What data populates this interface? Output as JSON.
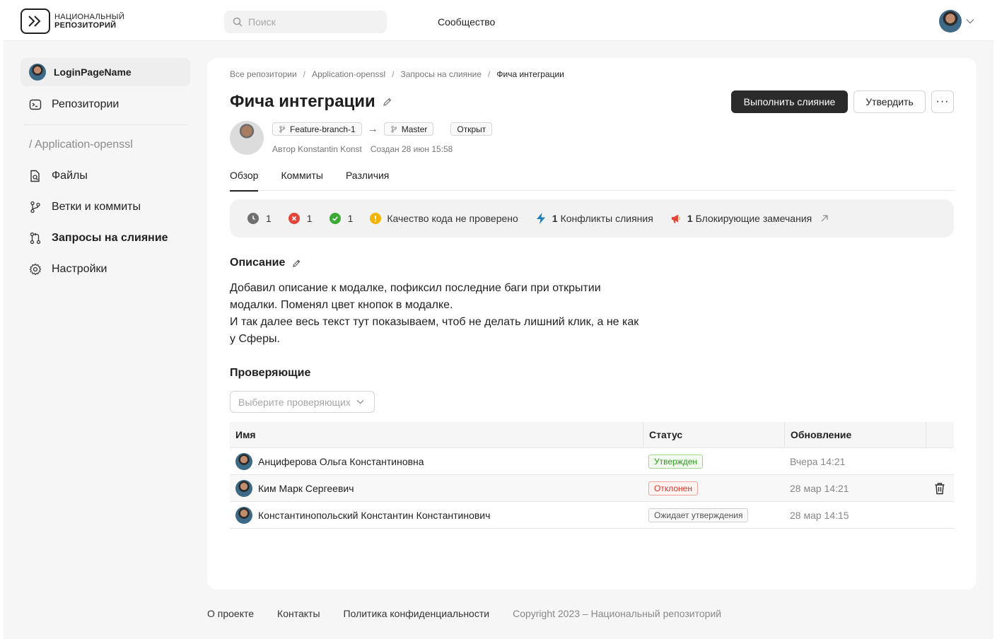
{
  "header": {
    "logo_line1": "НАЦИОНАЛЬНЫЙ",
    "logo_line2": "РЕПОЗИТОРИЙ",
    "search_placeholder": "Поиск",
    "community": "Сообщество"
  },
  "sidebar": {
    "user": "LoginPageName",
    "repos": "Репозитории",
    "repo_path": "/  Application-openssl",
    "items": [
      {
        "label": "Файлы",
        "icon": "file-search-icon"
      },
      {
        "label": "Ветки и коммиты",
        "icon": "branch-icon"
      },
      {
        "label": "Запросы на слияние",
        "icon": "pull-request-icon",
        "active": true
      },
      {
        "label": "Настройки",
        "icon": "gear-icon"
      }
    ]
  },
  "breadcrumb": [
    "Все репозитории",
    "Application-openssl",
    "Запросы на слияние",
    "Фича интеграции"
  ],
  "page": {
    "title": "Фича интеграции",
    "merge_button": "Выполнить слияние",
    "approve_button": "Утвердить",
    "more_button": "···",
    "source_branch": "Feature-branch-1",
    "target_branch": "Master",
    "status": "Открыт",
    "author": "Автор Konstantin Konst",
    "created": "Создан 28 июн 15:58"
  },
  "tabs": [
    "Обзор",
    "Коммиты",
    "Различия"
  ],
  "checks": {
    "pending": "1",
    "failed": "1",
    "passed": "1",
    "quality": "Качество кода не проверено",
    "conflicts_count": "1",
    "conflicts_label": "Конфликты слияния",
    "blocking_count": "1",
    "blocking_label": "Блокирующие замечания"
  },
  "description": {
    "title": "Описание",
    "lines": [
      "Добавил описание к модалке, пофиксил последние баги при открытии",
      "модалки. Поменял цвет кнопок в модалке.",
      "И так далее весь текст тут показываем, чтоб не делать лишний клик, а не как",
      "у Сферы."
    ]
  },
  "reviewers": {
    "title": "Проверяющие",
    "select_placeholder": "Выберите проверяющих",
    "columns": [
      "Имя",
      "Статус",
      "Обновление"
    ],
    "rows": [
      {
        "name": "Анциферова Ольга Константиновна",
        "status": "Утвержден",
        "updated": "Вчера 14:21"
      },
      {
        "name": "Ким Марк Сергеевич",
        "status": "Отклонен",
        "updated": "28 мар 14:21"
      },
      {
        "name": "Константинопольский Константин Константинович",
        "status": "Ожидает утверждения",
        "updated": "28 мар 14:15"
      }
    ]
  },
  "footer": {
    "about": "О проекте",
    "contacts": "Контакты",
    "privacy": "Политика конфиденциальности",
    "copyright": "Copyright 2023 – Национальный репозиторий"
  },
  "colors": {
    "primary_button": "#2b2b2b",
    "approved": "#2c9a1f",
    "rejected": "#d1362a",
    "accent_conflict": "#1e7fb0",
    "warning": "#f4b400"
  }
}
